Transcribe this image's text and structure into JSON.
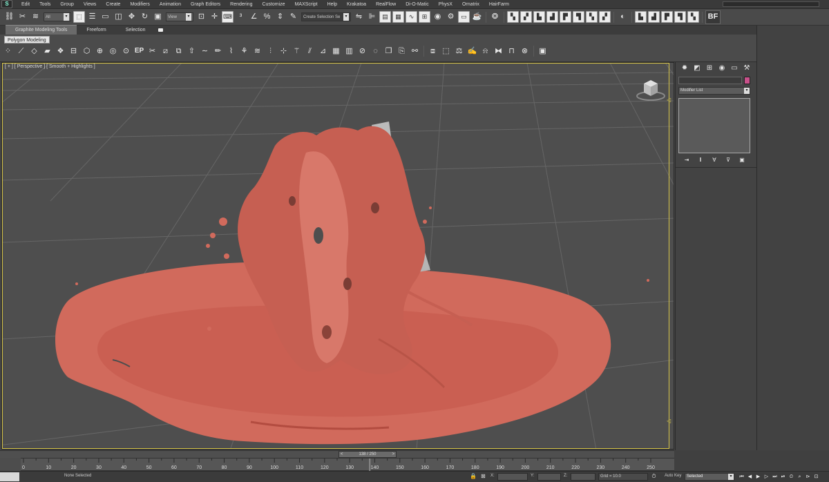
{
  "app": {
    "logo": "S"
  },
  "menu": [
    "Edit",
    "Tools",
    "Group",
    "Views",
    "Create",
    "Modifiers",
    "Animation",
    "Graph Editors",
    "Rendering",
    "Customize",
    "MAXScript",
    "Help",
    "Krakatoa",
    "RealFlow",
    "Di-O-Matic",
    "PhysX",
    "Ornatrix",
    "HairFarm"
  ],
  "toolbar": {
    "filter_value": "All",
    "coord_value": "View",
    "selection_set": "Create Selection Se",
    "bf_label": "BF"
  },
  "ribbon": {
    "tabs": [
      "Graphite Modeling Tools",
      "Freeform",
      "Selection"
    ],
    "panel_label": "Polygon Modeling",
    "ep_label": "EP"
  },
  "viewport": {
    "label": "[ + ] [ Perspective ] [ Smooth + Highlights ]",
    "fluid_color": "#d16a5c",
    "grid_color": "#6b6b6b",
    "background": "#4e4e4e"
  },
  "command_panel": {
    "modifier_list": "Modifier List",
    "object_color": "#c8508a"
  },
  "timeline": {
    "current_frame": "138 / 250",
    "prev": "<",
    "next": ">",
    "ticks": [
      0,
      10,
      20,
      30,
      40,
      50,
      60,
      70,
      80,
      90,
      100,
      110,
      120,
      130,
      140,
      150,
      160,
      170,
      180,
      190,
      200,
      210,
      220,
      230,
      240,
      250
    ]
  },
  "status": {
    "selection_text": "None Selected",
    "x_label": "X:",
    "y_label": "Y:",
    "z_label": "Z:",
    "grid": "Grid = 10.0",
    "auto_key": "Auto Key",
    "selected": "Selected"
  },
  "colors": {
    "accent_border": "#d9c74a"
  }
}
